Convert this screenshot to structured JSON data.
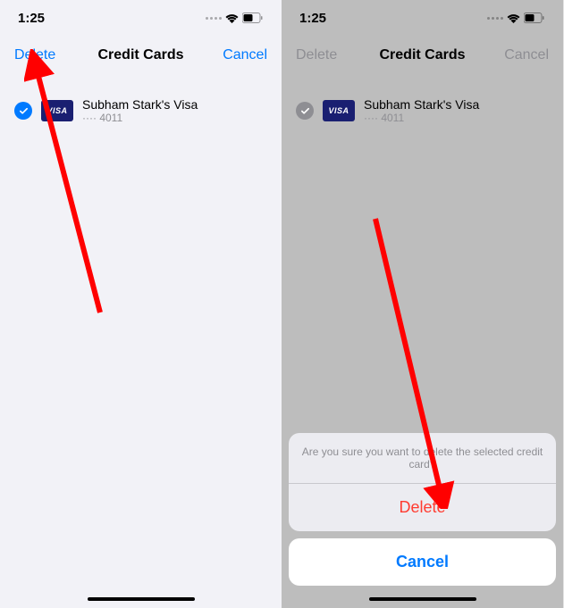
{
  "statusBar": {
    "time": "1:25"
  },
  "left": {
    "nav": {
      "delete": "Delete",
      "title": "Credit Cards",
      "cancel": "Cancel"
    },
    "card": {
      "visa": "VISA",
      "name": "Subham Stark's Visa",
      "number": "···· 4011"
    }
  },
  "right": {
    "nav": {
      "delete": "Delete",
      "title": "Credit Cards",
      "cancel": "Cancel"
    },
    "card": {
      "visa": "VISA",
      "name": "Subham Stark's Visa",
      "number": "···· 4011"
    },
    "sheet": {
      "prompt": "Are you sure you want to delete the selected credit card?",
      "delete": "Delete",
      "cancel": "Cancel"
    }
  }
}
